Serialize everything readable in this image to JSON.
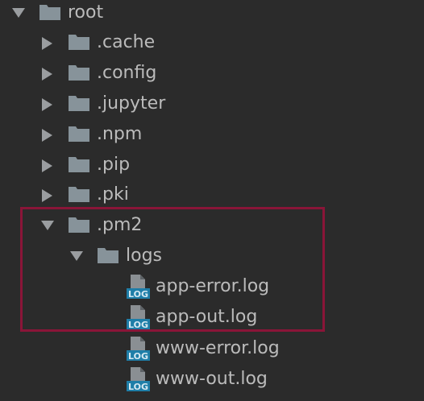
{
  "tree": {
    "root": {
      "label": "root",
      "expanded": true
    },
    "items": [
      {
        "label": ".cache",
        "type": "folder",
        "expanded": false
      },
      {
        "label": ".config",
        "type": "folder",
        "expanded": false
      },
      {
        "label": ".jupyter",
        "type": "folder",
        "expanded": false
      },
      {
        "label": ".npm",
        "type": "folder",
        "expanded": false
      },
      {
        "label": ".pip",
        "type": "folder",
        "expanded": false
      },
      {
        "label": ".pki",
        "type": "folder",
        "expanded": false
      },
      {
        "label": ".pm2",
        "type": "folder",
        "expanded": true
      },
      {
        "label": "logs",
        "type": "folder",
        "expanded": true
      },
      {
        "label": "app-error.log",
        "type": "log-file"
      },
      {
        "label": "app-out.log",
        "type": "log-file"
      },
      {
        "label": "www-error.log",
        "type": "log-file"
      },
      {
        "label": "www-out.log",
        "type": "log-file"
      }
    ],
    "log_icon_text": "LOG"
  },
  "colors": {
    "background": "#2b2b2b",
    "text": "#bbbbbb",
    "folder": "#87939a",
    "arrow": "#9a9da0",
    "log_badge": "#1f7ea8",
    "highlight_border": "#8a1538"
  },
  "icons": {
    "expanded_arrow": "triangle-down-icon",
    "collapsed_arrow": "triangle-right-icon",
    "folder": "folder-icon",
    "log_file": "log-file-icon"
  }
}
